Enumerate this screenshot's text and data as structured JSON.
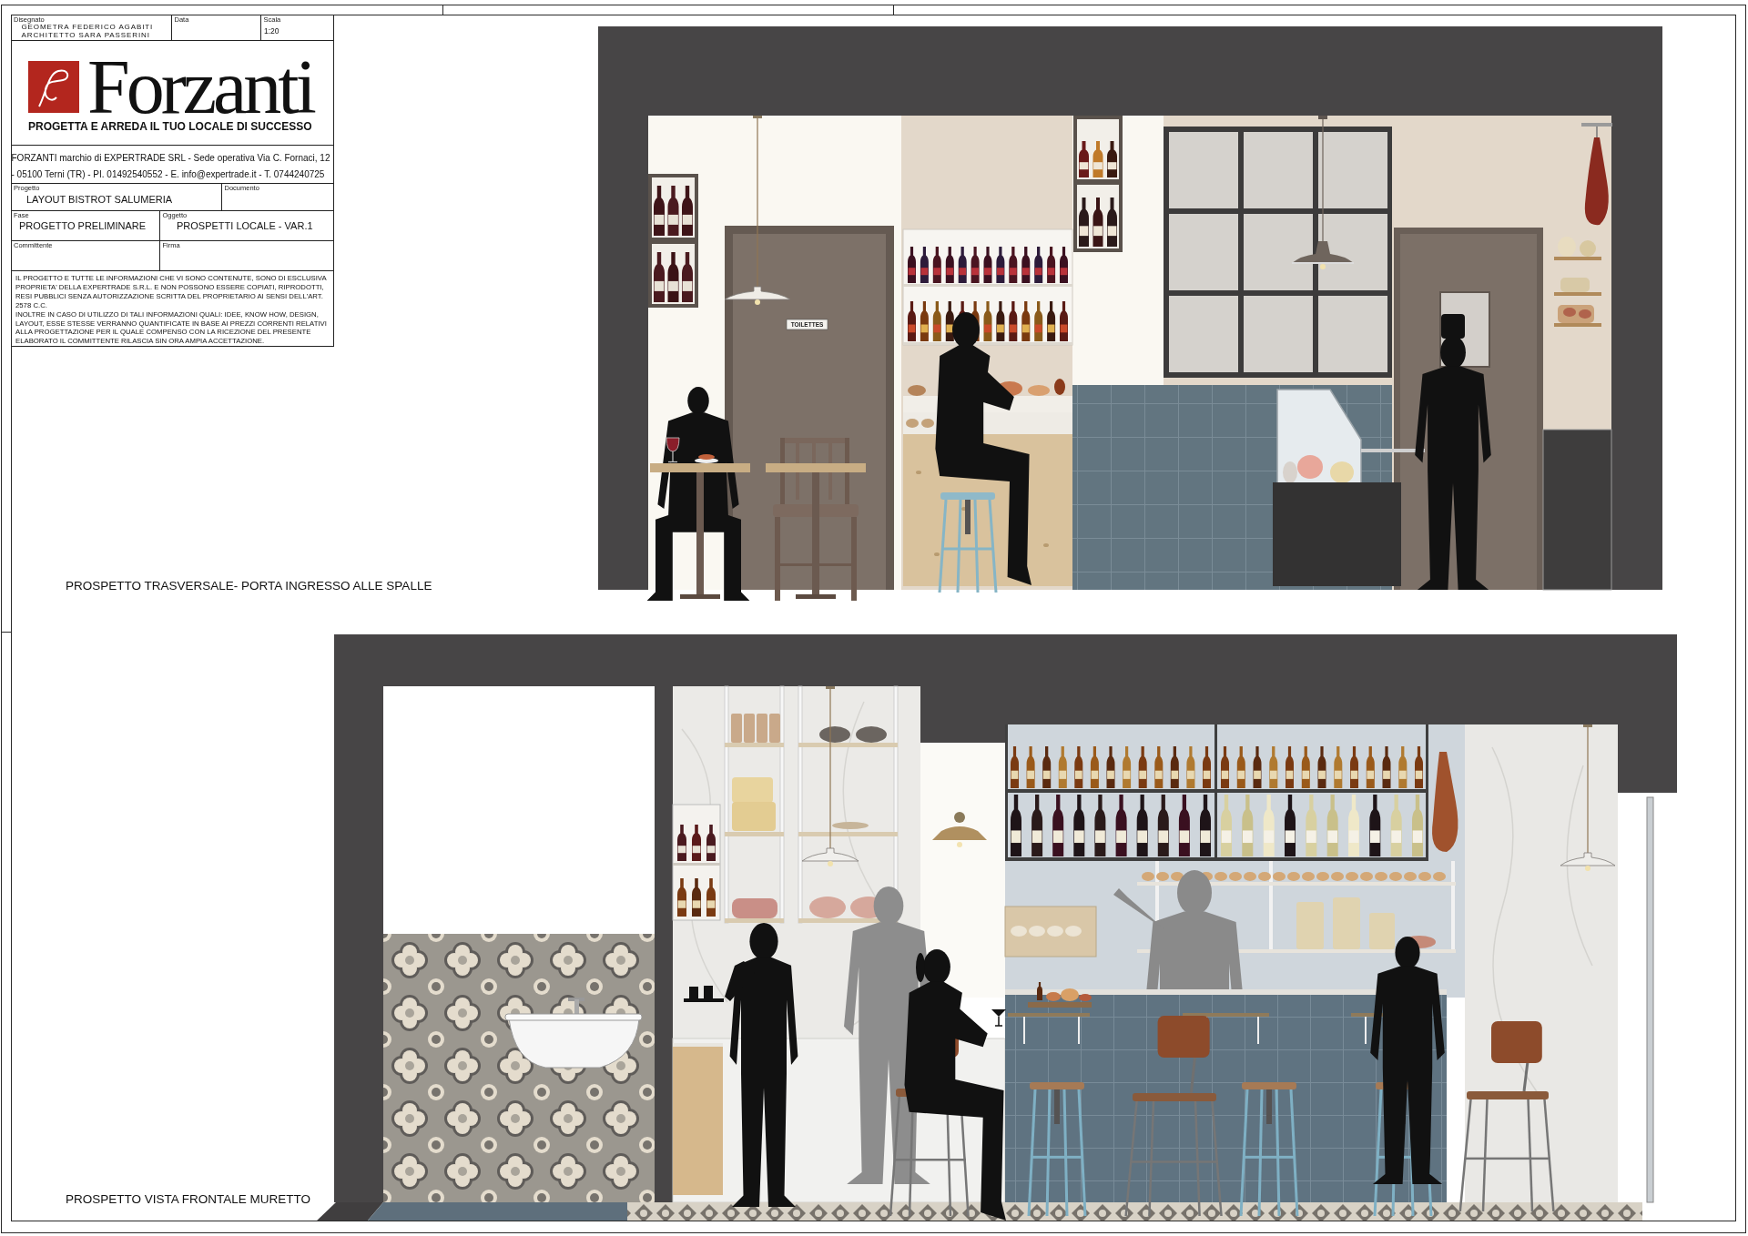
{
  "title_block": {
    "drawn_by": {
      "label": "Disegnato",
      "names": [
        "GEOMETRA FEDERICO AGABITI",
        "ARCHITETTO SARA PASSERINI"
      ]
    },
    "date": {
      "label": "Data"
    },
    "scale": {
      "label": "Scala",
      "value": "1:20"
    },
    "logo": {
      "wordmark": "Forzanti",
      "tagline": "PROGETTA E ARREDA IL TUO LOCALE DI SUCCESSO"
    },
    "company_info": "FORZANTI marchio di EXPERTRADE SRL - Sede operativa Via C. Fornaci, 12 - 05100 Terni (TR) - PI. 01492540552 - E. info@expertrade.it - T. 0744240725",
    "project": {
      "label": "Progetto",
      "value": "LAYOUT BISTROT SALUMERIA"
    },
    "document": {
      "label": "Documento"
    },
    "phase": {
      "label": "Fase",
      "value": "PROGETTO PRELIMINARE"
    },
    "subject": {
      "label": "Oggetto",
      "value": "PROSPETTI LOCALE - VAR.1"
    },
    "client": {
      "label": "Committente"
    },
    "signature": {
      "label": "Firma"
    },
    "disclaimer": [
      "IL PROGETTO E TUTTE LE INFORMAZIONI CHE VI SONO CONTENUTE, SONO DI ESCLUSIVA PROPRIETA' DELLA EXPERTRADE S.R.L. E NON POSSONO ESSERE COPIATI, RIPRODOTTI, RESI PUBBLICI SENZA AUTORIZZAZIONE SCRITTA DEL PROPRIETARIO AI SENSI DELL'ART. 2578 C.C.",
      "INOLTRE IN CASO DI UTILIZZO DI TALI INFORMAZIONI QUALI: IDEE, KNOW HOW, DESIGN, LAYOUT, ESSE STESSE VERRANNO QUANTIFICATE IN BASE AI PREZZI CORRENTI RELATIVI ALLA PROGETTAZIONE PER IL QUALE COMPENSO CON LA RICEZIONE DEL PRESENTE ELABORATO IL COMMITTENTE RILASCIA SIN ORA AMPIA ACCETTAZIONE."
    ]
  },
  "elevations": [
    {
      "kind": "transverse",
      "title": "PROSPETTO TRASVERSALE- PORTA INGRESSO ALLE SPALLE",
      "door_sign": "TOILETTES"
    },
    {
      "kind": "frontal",
      "title": "PROSPETTO VISTA FRONTALE MURETTO"
    }
  ]
}
